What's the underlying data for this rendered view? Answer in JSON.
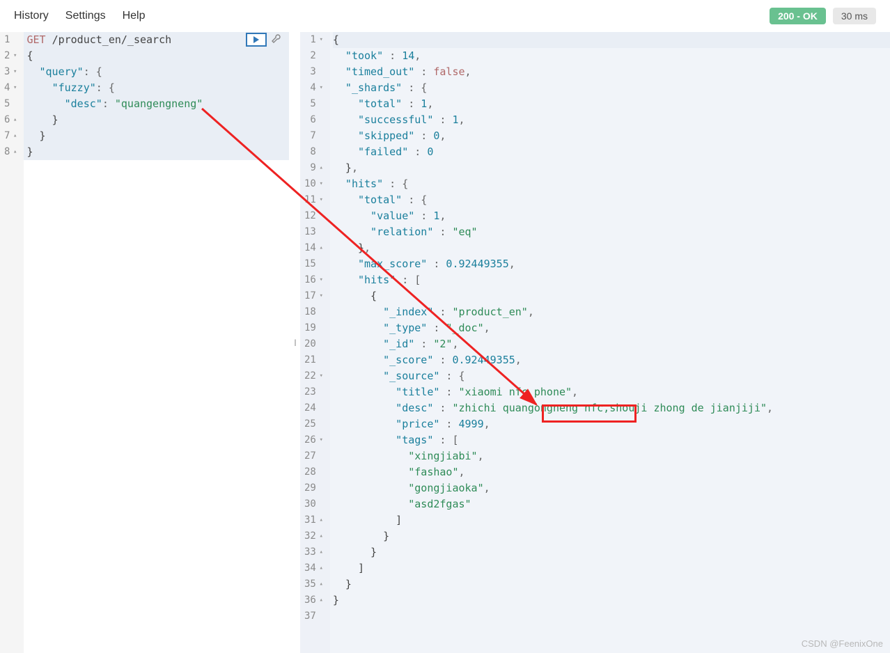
{
  "menu": {
    "history": "History",
    "settings": "Settings",
    "help": "Help"
  },
  "status": {
    "code": "200 - OK",
    "time": "30 ms"
  },
  "request": {
    "method": "GET",
    "path": "/product_en/_search",
    "lines": [
      {
        "n": "1",
        "fold": ""
      },
      {
        "n": "2",
        "fold": "▾"
      },
      {
        "n": "3",
        "fold": "▾"
      },
      {
        "n": "4",
        "fold": "▾"
      },
      {
        "n": "5",
        "fold": ""
      },
      {
        "n": "6",
        "fold": "▴"
      },
      {
        "n": "7",
        "fold": "▴"
      },
      {
        "n": "8",
        "fold": "▴"
      }
    ],
    "body": {
      "l2": "{",
      "l3_key": "\"query\"",
      "l3_rest": ": {",
      "l4_key": "\"fuzzy\"",
      "l4_rest": ": {",
      "l5_key": "\"desc\"",
      "l5_val": "\"quangengneng\"",
      "l6": "}",
      "l7": "}",
      "l8": "}"
    }
  },
  "response": {
    "lines": [
      {
        "n": "1",
        "f": "▾"
      },
      {
        "n": "2",
        "f": ""
      },
      {
        "n": "3",
        "f": ""
      },
      {
        "n": "4",
        "f": "▾"
      },
      {
        "n": "5",
        "f": ""
      },
      {
        "n": "6",
        "f": ""
      },
      {
        "n": "7",
        "f": ""
      },
      {
        "n": "8",
        "f": ""
      },
      {
        "n": "9",
        "f": "▴"
      },
      {
        "n": "10",
        "f": "▾"
      },
      {
        "n": "11",
        "f": "▾"
      },
      {
        "n": "12",
        "f": ""
      },
      {
        "n": "13",
        "f": ""
      },
      {
        "n": "14",
        "f": "▴"
      },
      {
        "n": "15",
        "f": ""
      },
      {
        "n": "16",
        "f": "▾"
      },
      {
        "n": "17",
        "f": "▾"
      },
      {
        "n": "18",
        "f": ""
      },
      {
        "n": "19",
        "f": ""
      },
      {
        "n": "20",
        "f": ""
      },
      {
        "n": "21",
        "f": ""
      },
      {
        "n": "22",
        "f": "▾"
      },
      {
        "n": "23",
        "f": ""
      },
      {
        "n": "24",
        "f": ""
      },
      {
        "n": "25",
        "f": ""
      },
      {
        "n": "26",
        "f": "▾"
      },
      {
        "n": "27",
        "f": ""
      },
      {
        "n": "28",
        "f": ""
      },
      {
        "n": "29",
        "f": ""
      },
      {
        "n": "30",
        "f": ""
      },
      {
        "n": "31",
        "f": "▴"
      },
      {
        "n": "32",
        "f": "▴"
      },
      {
        "n": "33",
        "f": "▴"
      },
      {
        "n": "34",
        "f": "▴"
      },
      {
        "n": "35",
        "f": "▴"
      },
      {
        "n": "36",
        "f": "▴"
      },
      {
        "n": "37",
        "f": ""
      }
    ],
    "t": {
      "took_k": "\"took\"",
      "took_v": "14",
      "timed_k": "\"timed_out\"",
      "timed_v": "false",
      "shards_k": "\"_shards\"",
      "total_k": "\"total\"",
      "total_v": "1",
      "succ_k": "\"successful\"",
      "succ_v": "1",
      "skip_k": "\"skipped\"",
      "skip_v": "0",
      "fail_k": "\"failed\"",
      "fail_v": "0",
      "hits_k": "\"hits\"",
      "htotal_k": "\"total\"",
      "value_k": "\"value\"",
      "value_v": "1",
      "rel_k": "\"relation\"",
      "rel_v": "\"eq\"",
      "maxs_k": "\"max_score\"",
      "maxs_v": "0.92449355",
      "hitsarr_k": "\"hits\"",
      "index_k": "\"_index\"",
      "index_v": "\"product_en\"",
      "type_k": "\"_type\"",
      "type_v": "\"_doc\"",
      "id_k": "\"_id\"",
      "id_v": "\"2\"",
      "score_k": "\"_score\"",
      "score_v": "0.92449355",
      "source_k": "\"_source\"",
      "title_k": "\"title\"",
      "title_v": "\"xiaomi nfc phone\"",
      "desc_k": "\"desc\"",
      "desc_v1": "\"zhichi ",
      "desc_v2": "quangongneng",
      "desc_v3": " nfc,shouji zhong de jianjiji\"",
      "price_k": "\"price\"",
      "price_v": "4999",
      "tags_k": "\"tags\"",
      "tag1": "\"xingjiabi\"",
      "tag2": "\"fashao\"",
      "tag3": "\"gongjiaoka\"",
      "tag4": "\"asd2fgas\""
    }
  },
  "watermark": "CSDN @FeenixOne"
}
